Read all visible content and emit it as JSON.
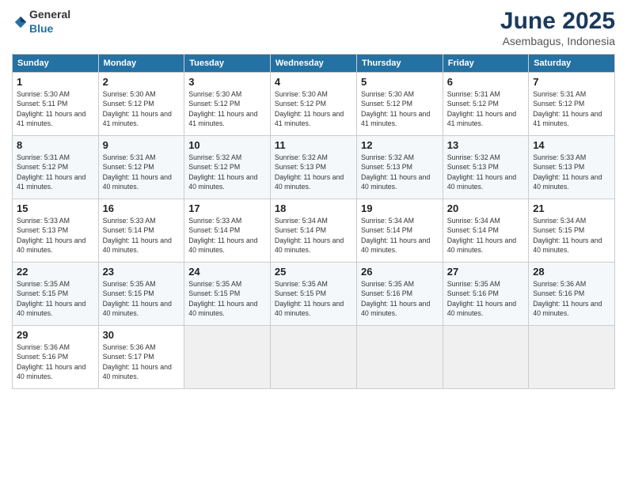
{
  "logo": {
    "general": "General",
    "blue": "Blue"
  },
  "header": {
    "month": "June 2025",
    "location": "Asembagus, Indonesia"
  },
  "weekdays": [
    "Sunday",
    "Monday",
    "Tuesday",
    "Wednesday",
    "Thursday",
    "Friday",
    "Saturday"
  ],
  "days": [
    {
      "date": 1,
      "col": 0,
      "sunrise": "5:30 AM",
      "sunset": "5:11 PM",
      "daylight": "11 hours and 41 minutes"
    },
    {
      "date": 2,
      "col": 1,
      "sunrise": "5:30 AM",
      "sunset": "5:12 PM",
      "daylight": "11 hours and 41 minutes"
    },
    {
      "date": 3,
      "col": 2,
      "sunrise": "5:30 AM",
      "sunset": "5:12 PM",
      "daylight": "11 hours and 41 minutes"
    },
    {
      "date": 4,
      "col": 3,
      "sunrise": "5:30 AM",
      "sunset": "5:12 PM",
      "daylight": "11 hours and 41 minutes"
    },
    {
      "date": 5,
      "col": 4,
      "sunrise": "5:30 AM",
      "sunset": "5:12 PM",
      "daylight": "11 hours and 41 minutes"
    },
    {
      "date": 6,
      "col": 5,
      "sunrise": "5:31 AM",
      "sunset": "5:12 PM",
      "daylight": "11 hours and 41 minutes"
    },
    {
      "date": 7,
      "col": 6,
      "sunrise": "5:31 AM",
      "sunset": "5:12 PM",
      "daylight": "11 hours and 41 minutes"
    },
    {
      "date": 8,
      "col": 0,
      "sunrise": "5:31 AM",
      "sunset": "5:12 PM",
      "daylight": "11 hours and 41 minutes"
    },
    {
      "date": 9,
      "col": 1,
      "sunrise": "5:31 AM",
      "sunset": "5:12 PM",
      "daylight": "11 hours and 40 minutes"
    },
    {
      "date": 10,
      "col": 2,
      "sunrise": "5:32 AM",
      "sunset": "5:12 PM",
      "daylight": "11 hours and 40 minutes"
    },
    {
      "date": 11,
      "col": 3,
      "sunrise": "5:32 AM",
      "sunset": "5:13 PM",
      "daylight": "11 hours and 40 minutes"
    },
    {
      "date": 12,
      "col": 4,
      "sunrise": "5:32 AM",
      "sunset": "5:13 PM",
      "daylight": "11 hours and 40 minutes"
    },
    {
      "date": 13,
      "col": 5,
      "sunrise": "5:32 AM",
      "sunset": "5:13 PM",
      "daylight": "11 hours and 40 minutes"
    },
    {
      "date": 14,
      "col": 6,
      "sunrise": "5:33 AM",
      "sunset": "5:13 PM",
      "daylight": "11 hours and 40 minutes"
    },
    {
      "date": 15,
      "col": 0,
      "sunrise": "5:33 AM",
      "sunset": "5:13 PM",
      "daylight": "11 hours and 40 minutes"
    },
    {
      "date": 16,
      "col": 1,
      "sunrise": "5:33 AM",
      "sunset": "5:14 PM",
      "daylight": "11 hours and 40 minutes"
    },
    {
      "date": 17,
      "col": 2,
      "sunrise": "5:33 AM",
      "sunset": "5:14 PM",
      "daylight": "11 hours and 40 minutes"
    },
    {
      "date": 18,
      "col": 3,
      "sunrise": "5:34 AM",
      "sunset": "5:14 PM",
      "daylight": "11 hours and 40 minutes"
    },
    {
      "date": 19,
      "col": 4,
      "sunrise": "5:34 AM",
      "sunset": "5:14 PM",
      "daylight": "11 hours and 40 minutes"
    },
    {
      "date": 20,
      "col": 5,
      "sunrise": "5:34 AM",
      "sunset": "5:14 PM",
      "daylight": "11 hours and 40 minutes"
    },
    {
      "date": 21,
      "col": 6,
      "sunrise": "5:34 AM",
      "sunset": "5:15 PM",
      "daylight": "11 hours and 40 minutes"
    },
    {
      "date": 22,
      "col": 0,
      "sunrise": "5:35 AM",
      "sunset": "5:15 PM",
      "daylight": "11 hours and 40 minutes"
    },
    {
      "date": 23,
      "col": 1,
      "sunrise": "5:35 AM",
      "sunset": "5:15 PM",
      "daylight": "11 hours and 40 minutes"
    },
    {
      "date": 24,
      "col": 2,
      "sunrise": "5:35 AM",
      "sunset": "5:15 PM",
      "daylight": "11 hours and 40 minutes"
    },
    {
      "date": 25,
      "col": 3,
      "sunrise": "5:35 AM",
      "sunset": "5:15 PM",
      "daylight": "11 hours and 40 minutes"
    },
    {
      "date": 26,
      "col": 4,
      "sunrise": "5:35 AM",
      "sunset": "5:16 PM",
      "daylight": "11 hours and 40 minutes"
    },
    {
      "date": 27,
      "col": 5,
      "sunrise": "5:35 AM",
      "sunset": "5:16 PM",
      "daylight": "11 hours and 40 minutes"
    },
    {
      "date": 28,
      "col": 6,
      "sunrise": "5:36 AM",
      "sunset": "5:16 PM",
      "daylight": "11 hours and 40 minutes"
    },
    {
      "date": 29,
      "col": 0,
      "sunrise": "5:36 AM",
      "sunset": "5:16 PM",
      "daylight": "11 hours and 40 minutes"
    },
    {
      "date": 30,
      "col": 1,
      "sunrise": "5:36 AM",
      "sunset": "5:17 PM",
      "daylight": "11 hours and 40 minutes"
    }
  ],
  "labels": {
    "sunrise": "Sunrise:",
    "sunset": "Sunset:",
    "daylight": "Daylight:"
  }
}
